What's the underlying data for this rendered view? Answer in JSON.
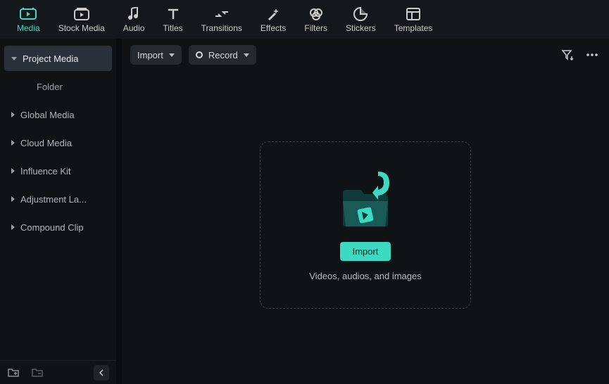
{
  "nav": {
    "items": [
      {
        "label": "Media"
      },
      {
        "label": "Stock Media"
      },
      {
        "label": "Audio"
      },
      {
        "label": "Titles"
      },
      {
        "label": "Transitions"
      },
      {
        "label": "Effects"
      },
      {
        "label": "Filters"
      },
      {
        "label": "Stickers"
      },
      {
        "label": "Templates"
      }
    ]
  },
  "sidebar": {
    "items": [
      {
        "label": "Project Media"
      },
      {
        "label": "Global Media"
      },
      {
        "label": "Cloud Media"
      },
      {
        "label": "Influence Kit"
      },
      {
        "label": "Adjustment La..."
      },
      {
        "label": "Compound Clip"
      }
    ],
    "sub": {
      "label": "Folder"
    }
  },
  "toolbar": {
    "import_label": "Import",
    "record_label": "Record"
  },
  "drop": {
    "button": "Import",
    "hint": "Videos, audios, and images"
  }
}
